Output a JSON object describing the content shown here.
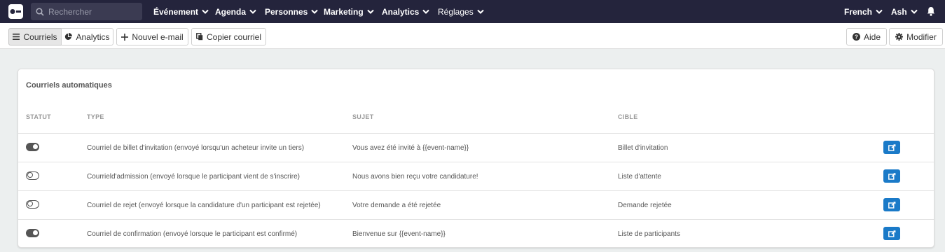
{
  "topbar": {
    "search_placeholder": "Rechercher",
    "nav": [
      {
        "label": "Événement"
      },
      {
        "label": "Agenda"
      },
      {
        "label": "Personnes"
      },
      {
        "label": "Marketing"
      },
      {
        "label": "Analytics"
      },
      {
        "label": "Réglages"
      }
    ],
    "language": "French",
    "user": "Ash"
  },
  "toolbar": {
    "emails_label": "Courriels",
    "analytics_label": "Analytics",
    "new_email_label": "Nouvel e-mail",
    "copy_email_label": "Copier courriel",
    "help_label": "Aide",
    "modify_label": "Modifier"
  },
  "card": {
    "title": "Courriels automatiques",
    "columns": {
      "status": "STATUT",
      "type": "TYPE",
      "subject": "SUJET",
      "target": "CIBLE"
    },
    "rows": [
      {
        "enabled": true,
        "type": "Courriel de billet d'invitation (envoyé lorsqu'un acheteur invite un tiers)",
        "subject": "Vous avez été invité à {{event-name}}",
        "target": "Billet d'invitation"
      },
      {
        "enabled": false,
        "type": "Courrield'admission (envoyé lorsque le participant vient de s'inscrire)",
        "subject": "Nous avons bien reçu votre candidature!",
        "target": "Liste d'attente"
      },
      {
        "enabled": false,
        "type": "Courriel de rejet (envoyé lorsque la candidature d'un participant est rejetée)",
        "subject": "Votre demande a été rejetée",
        "target": "Demande rejetée"
      },
      {
        "enabled": true,
        "type": "Courriel de confirmation (envoyé lorsque le participant est confirmé)",
        "subject": "Bienvenue sur {{event-name}}",
        "target": "Liste de participants"
      }
    ]
  },
  "colors": {
    "topbar": "#24243c",
    "accent": "#1a7ac8"
  }
}
